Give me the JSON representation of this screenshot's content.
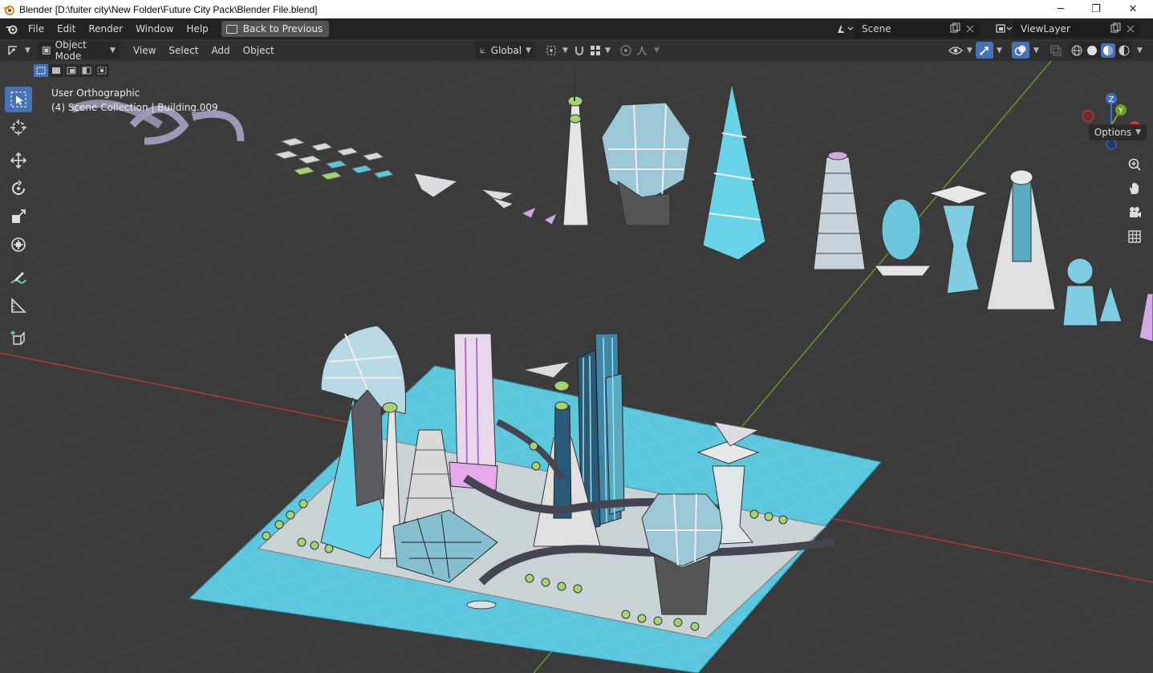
{
  "window": {
    "title": "Blender [D:\\fuiter city\\New Folder\\Future City Pack\\Blender File.blend]",
    "minimize_glyph": "─",
    "restore_glyph": "❐",
    "close_glyph": "✕"
  },
  "menu": {
    "items": [
      "File",
      "Edit",
      "Render",
      "Window",
      "Help"
    ],
    "back_label": "Back to Previous",
    "scene_label": "Scene",
    "viewlayer_label": "ViewLayer"
  },
  "header": {
    "mode_label": "Object Mode",
    "menus": [
      "View",
      "Select",
      "Add",
      "Object"
    ],
    "transform_orientation": "Global"
  },
  "viewport": {
    "view_name": "User Orthographic",
    "collection_info": "(4) Scene Collection | Building.009",
    "options_label": "Options",
    "gizmo_axes": [
      "X",
      "Y",
      "Z"
    ]
  },
  "colors": {
    "accent": "#4772b3",
    "ground_plane": "#5cc7dc",
    "x_axis": "#b53a3a",
    "y_axis": "#6a9b2a",
    "grid_bg": "#3b3b3b"
  },
  "icons": {
    "tools": [
      "select-box-icon",
      "cursor-icon",
      "move-icon",
      "rotate-icon",
      "scale-icon",
      "transform-icon",
      "annotate-icon",
      "measure-icon",
      "add-cube-icon"
    ],
    "nav": [
      "zoom-icon",
      "hand-pan-icon",
      "camera-view-icon",
      "grid-view-icon"
    ]
  }
}
